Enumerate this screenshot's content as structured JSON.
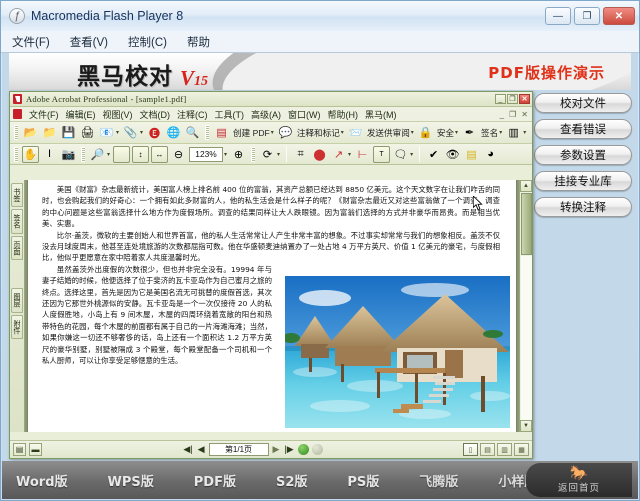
{
  "player_window": {
    "title": "Macromedia Flash Player 8",
    "icon": "flash-icon",
    "menus": [
      "文件(F)",
      "查看(V)",
      "控制(C)",
      "帮助"
    ],
    "controls": {
      "minimize": "—",
      "maximize": "❐",
      "close": "✕"
    }
  },
  "banner": {
    "logo_text": "黑马校对",
    "logo_version_mark": "V",
    "logo_version_number": "15",
    "subtitle": "PDF版操作演示"
  },
  "side_buttons": [
    {
      "label": "校对文件"
    },
    {
      "label": "查看错误"
    },
    {
      "label": "参数设置"
    },
    {
      "label": "挂接专业库"
    },
    {
      "label": "转换注释"
    }
  ],
  "acrobat": {
    "title": "Adobe Acrobat Professional - [sample1.pdf]",
    "controls": {
      "minimize": "_",
      "restore": "❐",
      "close": "✕"
    },
    "doc_controls": {
      "minimize": "_",
      "restore": "❐",
      "close": "✕"
    },
    "menus": [
      "文件(F)",
      "编辑(E)",
      "视图(V)",
      "文档(D)",
      "注释(C)",
      "工具(T)",
      "高级(A)",
      "窗口(W)",
      "帮助(H)",
      "黑马(M)"
    ],
    "toolbar1": {
      "icons": [
        "open-folder-icon",
        "open-file-icon",
        "save-icon",
        "print-icon",
        "email-icon",
        "attach-icon",
        "stamp-icon",
        "web-capture-icon",
        "search-icon"
      ],
      "create_pdf_label": "创建 PDF",
      "comment_markup_label": "注释和标记",
      "send_review_label": "发送供审阅",
      "security_label": "安全",
      "sign_label": "签名",
      "forms_label": "表单"
    },
    "toolbar2": {
      "zoom_value": "123%",
      "icons": [
        "hand-tool-icon",
        "select-text-icon",
        "snapshot-icon",
        "zoom-in-tool-icon",
        "actual-size-icon",
        "fit-page-icon",
        "fit-width-icon",
        "zoom-out-icon",
        "zoom-in-icon",
        "rotate-icon",
        "crop-icon",
        "oval-icon",
        "arrow-icon",
        "dimension-icon",
        "textbox-icon",
        "note-icon",
        "highlight-icon",
        "eye-icon",
        "sticky-note-icon",
        "attach-note-icon"
      ]
    },
    "left_tabs": [
      "书签",
      "签名",
      "页面",
      "图层",
      "附件"
    ],
    "document": {
      "paragraphs": [
        "美国《财富》杂志最新统计，美国富人榜上排名前 400 位的富翁，其资产总额已经达到 8850 亿美元。这个天文数字在让我们咋舌的同时，也会购起我们的好奇心：一个拥有如此多财富的人，他的私生活会是什么样子的呢？《财富杂志最近又对这些富翁做了一个调查，调查的中心问题是这些富翁选择什么地方作为度假场所。调查的结果同样让大人跌眼镜。因为富翁们选择的方式并非豪华而昂贵。而是相当优美、实惠。",
        "比尔·盖茨，微软的主要创始人和世界首富，他的私人生活常常让人产生非常丰富的想象。不过事实却常常与我们的想象相反。盖茨不仅没去月球度周末，他甚至连处境旅游的次数都屈指可数。他在华盛顿麦迪纳置办了一处占地 4 万平方英尺、价值 1 亿美元的豪宅，与度假相比，他似乎更愿意在家中陪着家人共度温馨时光。",
        "虽然盖茨外出度假的次数很少，但也并非完全没有。19994 年与妻子结婚的时候，他便选择了位于斐济的瓦卡亚岛作为自己蜜月之旅的终点。选择这里，首先是因为它是美国名流无可挑替的度假首选，其次还因为它那世外桃源似的安静。瓦卡亚岛是一个一次仅接待 20 人的私人度假胜地，小岛上有 9 间木屋，木屋的四周环绕着宽敞的阳台和热带特色的花园，每个木屋的前面都有属于自己的一片海滩海滩；当然，如果你嫌这一切还不够奢侈的话，岛上还有一个面积达 1.2 万平方英尺的豪华别墅，别墅被隔成 3 个殿堂，每个殿堂配备一个司机和一个私人厨师，可以让你享受足够惬意的生活。"
      ],
      "image_alt": "tropical-overwater-bungalows-photo"
    },
    "status": {
      "page_indicator": "第1/1页",
      "first_page": "◀|",
      "prev_page": "◀",
      "next_page": "▶",
      "last_page": "|▶"
    }
  },
  "bottom_nav": {
    "items": [
      "Word版",
      "WPS版",
      "PDF版",
      "S2版",
      "PS版",
      "飞腾版",
      "小样版"
    ],
    "home_button": {
      "label": "返回首页",
      "icon": "horse-logo-icon"
    }
  },
  "colors": {
    "accent_red": "#e03017",
    "acrobat_green": "#e9eed8",
    "banner_gray": "#d8d8d8"
  }
}
